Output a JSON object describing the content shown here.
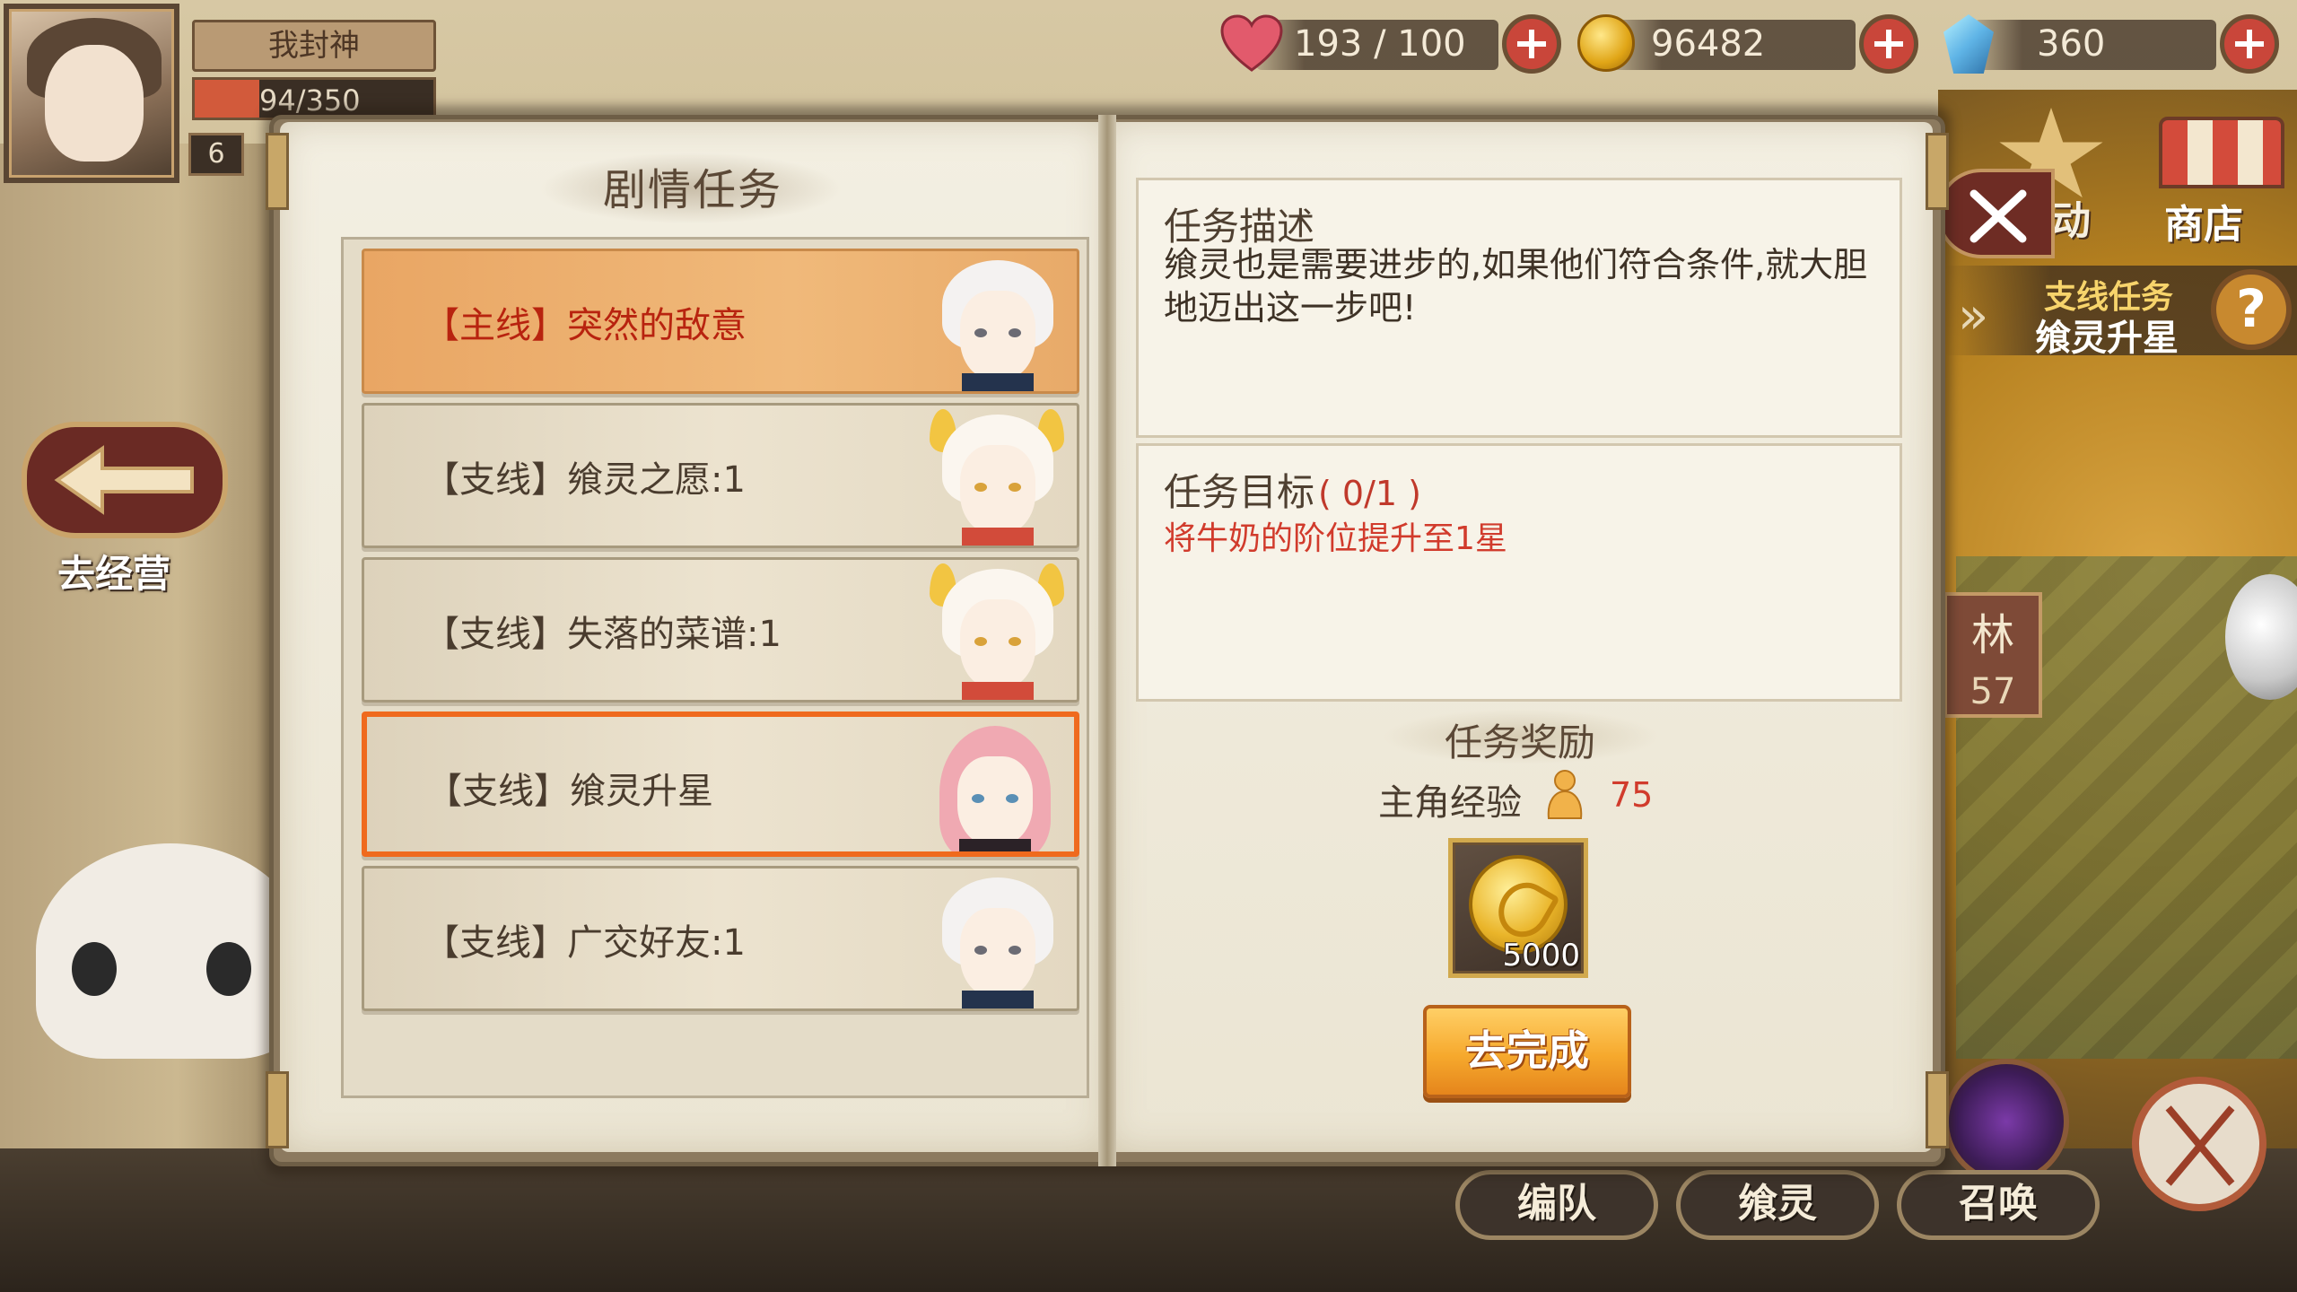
{
  "player": {
    "name": "我封神",
    "hp_text": "94/350",
    "hp_fraction": 0.27,
    "level": "6"
  },
  "resources": {
    "stamina": "193 / 100",
    "gold": "96482",
    "gems": "360"
  },
  "side": {
    "go_manage_label": "去经营",
    "activity_label": "动",
    "shop_label": "商店",
    "quest_tip_type": "支线任务",
    "quest_tip_name": "飨灵升星",
    "help_label": "?",
    "zone_name": "林",
    "zone_number": "57"
  },
  "bottom": {
    "team_label": "编队",
    "spirit_label": "飨灵",
    "summon_label": "召唤"
  },
  "book": {
    "list_title": "剧情任务",
    "quests": [
      {
        "label": "【主线】突然的敌意",
        "type": "main",
        "avatar": "white-hair-boy"
      },
      {
        "label": "【支线】飨灵之愿:1",
        "type": "side",
        "avatar": "white-hair-girl"
      },
      {
        "label": "【支线】失落的菜谱:1",
        "type": "side",
        "avatar": "white-hair-girl"
      },
      {
        "label": "【支线】飨灵升星",
        "type": "side",
        "selected": true,
        "avatar": "pink-hair-boy"
      },
      {
        "label": "【支线】广交好友:1",
        "type": "side",
        "avatar": "white-hair-boy"
      }
    ],
    "desc_title": "任务描述",
    "desc_body": "飨灵也是需要进步的,如果他们符合条件,就大胆地迈出这一步吧!",
    "goal_title": "任务目标",
    "goal_progress": "( 0/1 )",
    "goal_text": "将牛奶的阶位提升至1星",
    "reward_title": "任务奖励",
    "exp_label": "主角经验",
    "exp_value": "75",
    "reward_qty": "5000",
    "go_button": "去完成"
  },
  "colors": {
    "main_quest_red": "#b8230f",
    "selected_border": "#ef6a1e",
    "goal_red": "#d13b2c"
  }
}
